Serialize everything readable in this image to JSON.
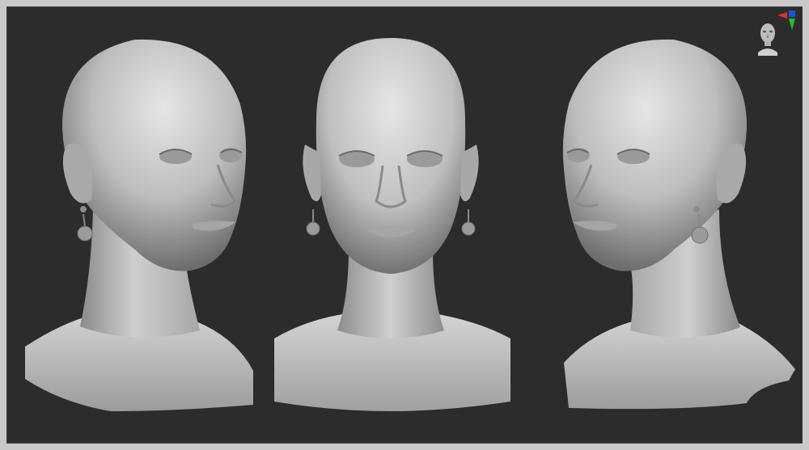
{
  "viewport": {
    "background_color": "#2c2c2c",
    "frame_color": "#c9c9c9",
    "material_color": "#d8d8d8"
  },
  "views": [
    {
      "name": "three-quarter-left",
      "icon": "sculpt-head-icon"
    },
    {
      "name": "front",
      "icon": "sculpt-head-icon"
    },
    {
      "name": "three-quarter-right",
      "icon": "sculpt-head-icon"
    }
  ],
  "navigator": {
    "icon": "head-orientation-icon",
    "axis_colors": {
      "x": "#e03030",
      "y": "#20c030",
      "z": "#2050e0"
    }
  }
}
